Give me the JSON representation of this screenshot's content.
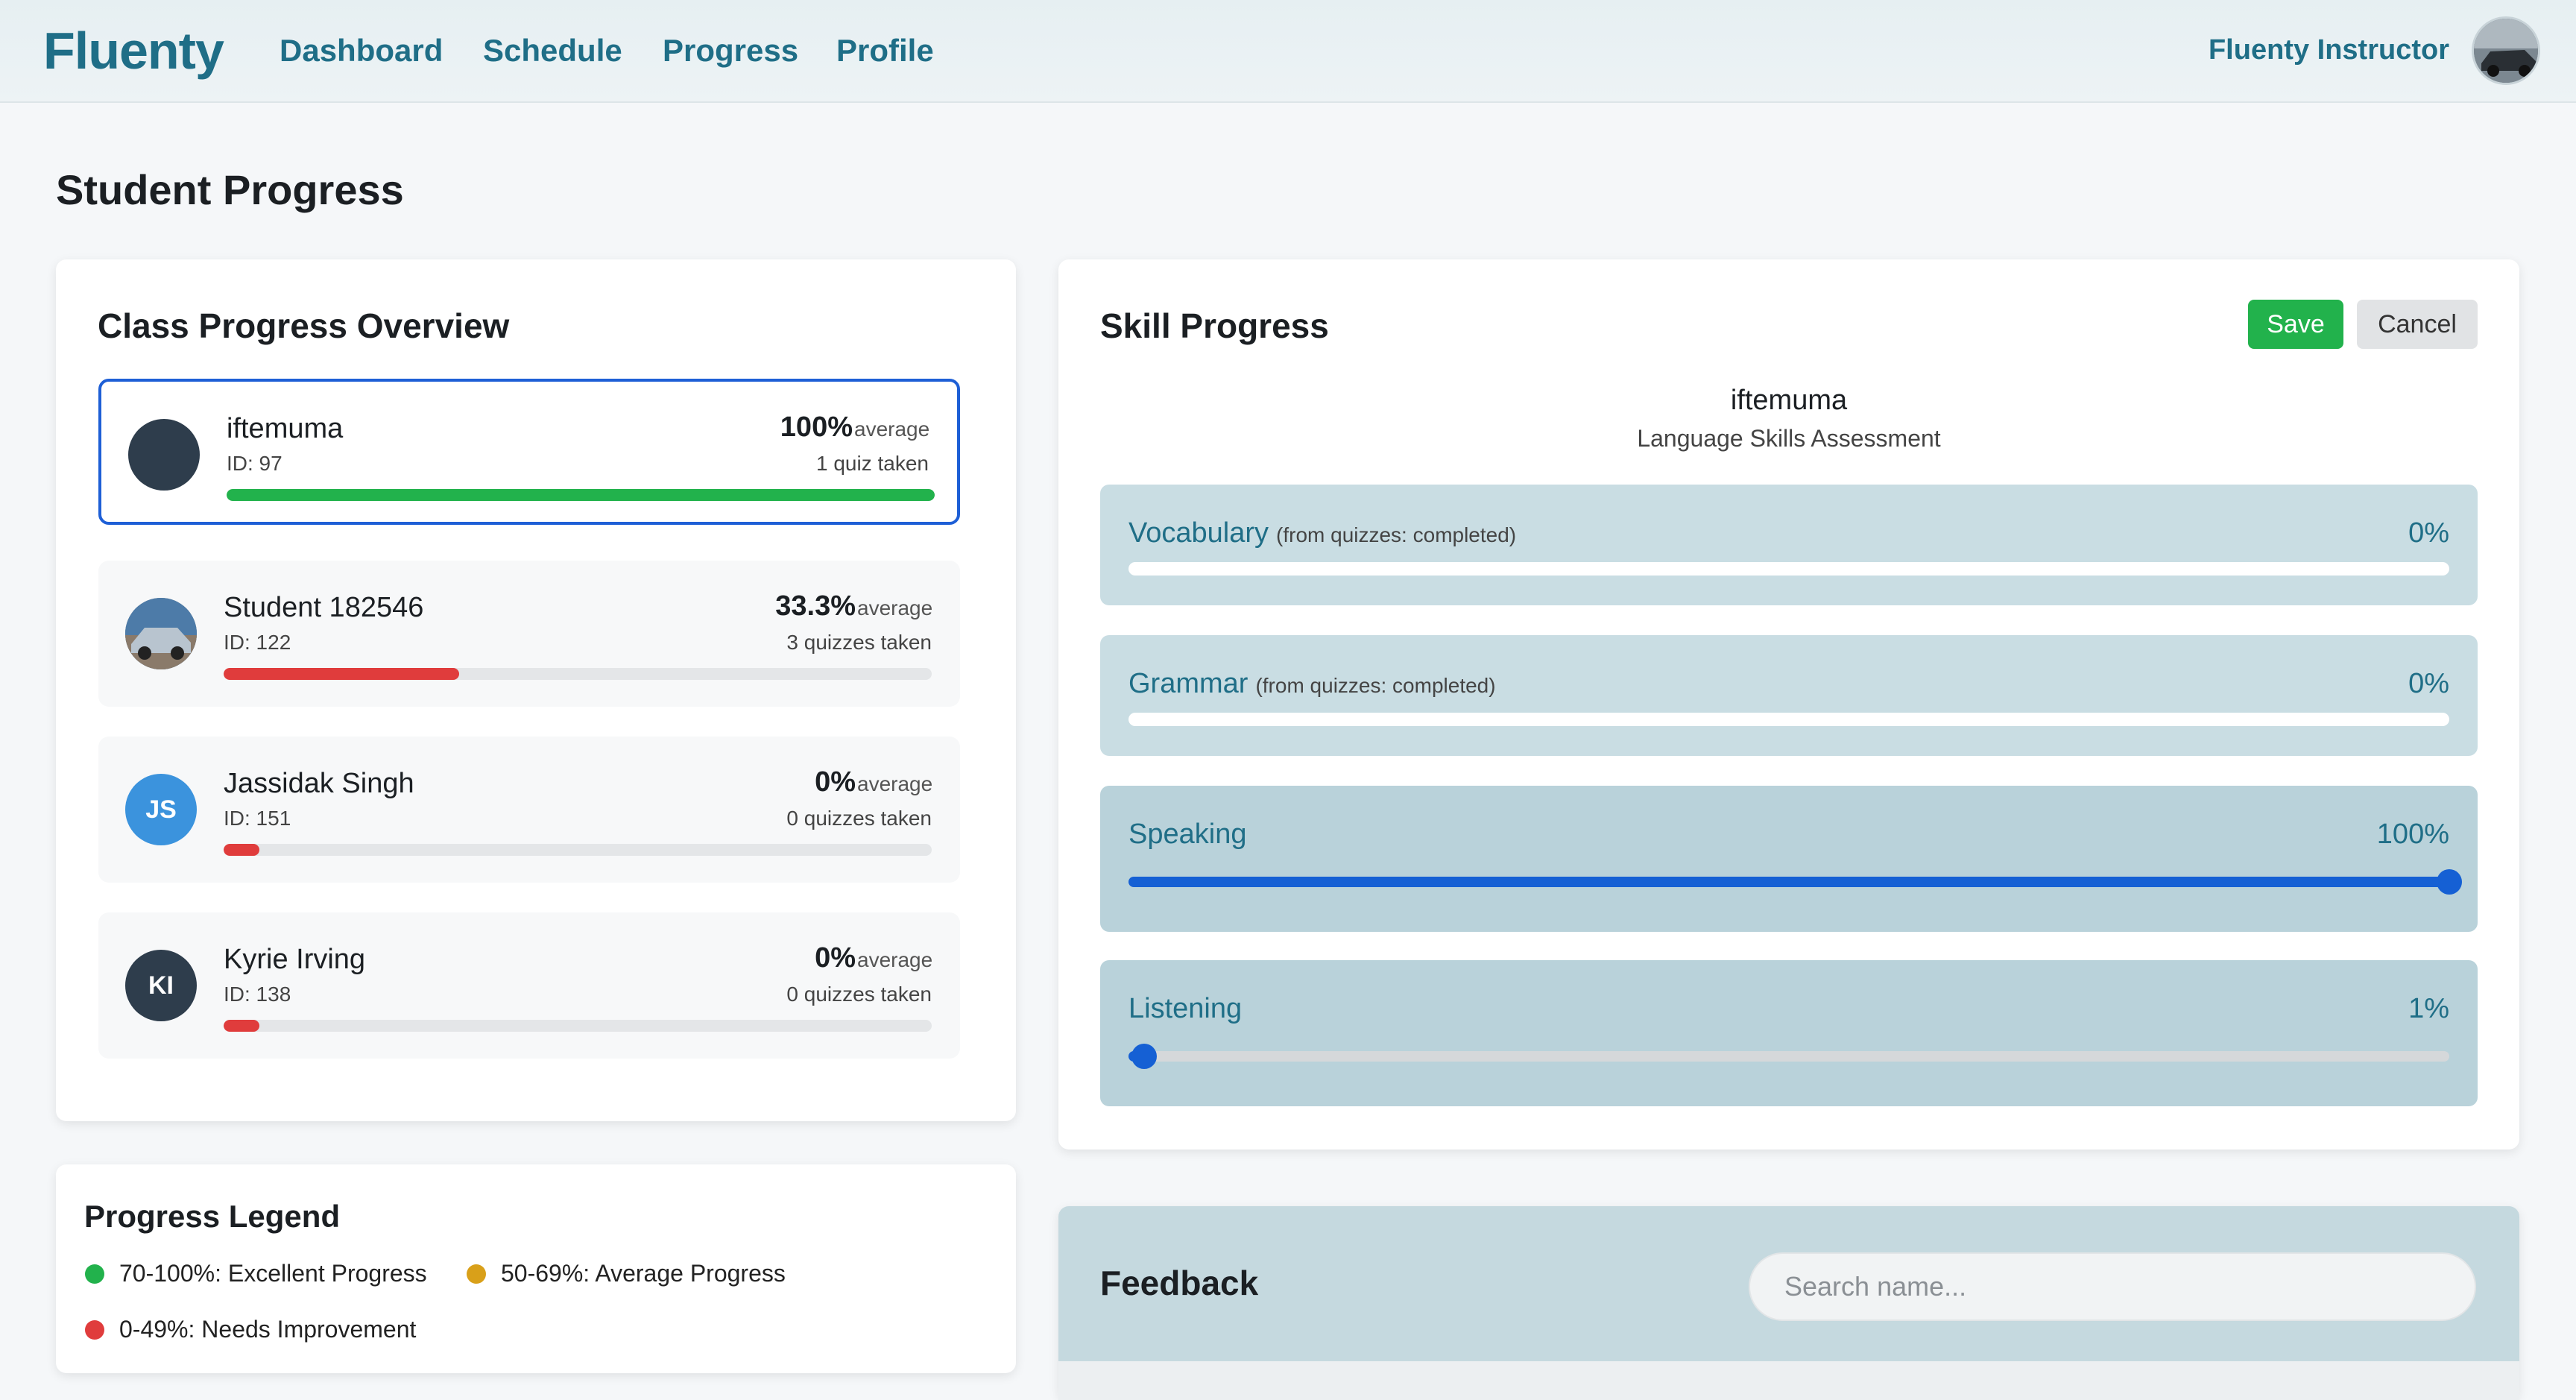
{
  "app": {
    "logo": "Fluenty",
    "nav": [
      "Dashboard",
      "Schedule",
      "Progress",
      "Profile"
    ],
    "user_name": "Fluenty Instructor",
    "accent_color": "#1f6e87"
  },
  "page": {
    "title": "Student Progress"
  },
  "class_overview": {
    "title": "Class Progress Overview",
    "students": [
      {
        "name": "iftemuma",
        "id": "ID: 97",
        "percent": "100%",
        "avg_label": "average",
        "quizzes": "1 quiz taken",
        "progress": 1.0,
        "bar_color": "#22b24c",
        "initials": "",
        "selected": true
      },
      {
        "name": "Student 182546",
        "id": "ID: 122",
        "percent": "33.3%",
        "avg_label": "average",
        "quizzes": "3 quizzes taken",
        "progress": 0.333,
        "bar_color": "#e03c3c",
        "initials": ""
      },
      {
        "name": "Jassidak Singh",
        "id": "ID: 151",
        "percent": "0%",
        "avg_label": "average",
        "quizzes": "0 quizzes taken",
        "progress": 0.0,
        "bar_color": "#e03c3c",
        "initials": "JS"
      },
      {
        "name": "Kyrie Irving",
        "id": "ID: 138",
        "percent": "0%",
        "avg_label": "average",
        "quizzes": "0 quizzes taken",
        "progress": 0.0,
        "bar_color": "#e03c3c",
        "initials": "KI"
      }
    ]
  },
  "skill_progress": {
    "title": "Skill Progress",
    "save_label": "Save",
    "cancel_label": "Cancel",
    "student_name": "iftemuma",
    "subtitle": "Language Skills Assessment",
    "skills": [
      {
        "name": "Vocabulary",
        "source": "(from quizzes: completed)",
        "percent": "0%",
        "value": 0
      },
      {
        "name": "Grammar",
        "source": "(from quizzes: completed)",
        "percent": "0%",
        "value": 0
      },
      {
        "name": "Speaking",
        "source": "",
        "percent": "100%",
        "value": 100
      },
      {
        "name": "Listening",
        "source": "",
        "percent": "1%",
        "value": 1
      }
    ]
  },
  "legend": {
    "title": "Progress Legend",
    "items": [
      {
        "label": "70-100%: Excellent Progress",
        "color": "#22b24c"
      },
      {
        "label": "50-69%: Average Progress",
        "color": "#d9a019"
      },
      {
        "label": "0-49%: Needs Improvement",
        "color": "#e03c3c"
      }
    ]
  },
  "feedback": {
    "title": "Feedback",
    "search_placeholder": "Search name..."
  }
}
